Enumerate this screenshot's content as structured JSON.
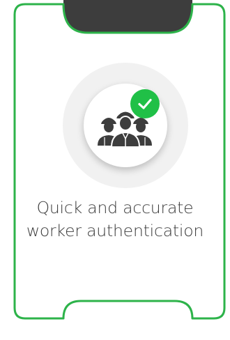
{
  "card": {
    "caption_line1": "Quick and accurate",
    "caption_line2": "worker authentication",
    "icon": "workers-group-icon",
    "status_icon": "check-icon",
    "colors": {
      "border": "#2db34a",
      "notch_fill": "#3d3d3d",
      "check_badge": "#20c047",
      "icon_ring": "#f1f1f1",
      "text": "#3a3a3a"
    }
  }
}
